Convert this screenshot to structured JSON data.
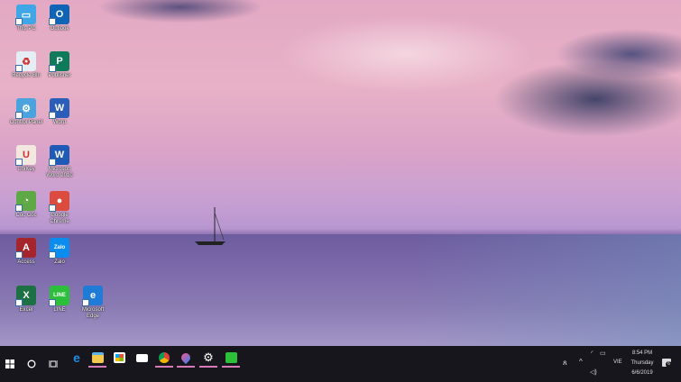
{
  "desktop_icons": [
    {
      "label": "This PC",
      "color": "#3fa7e6",
      "glyph": "▭"
    },
    {
      "label": "Outlook",
      "color": "#0f64b5",
      "glyph": "O"
    },
    {
      "label": "Recycle Bin",
      "color": "#e6eef5",
      "glyph": "♻"
    },
    {
      "label": "Publisher",
      "color": "#0e7a5a",
      "glyph": "P"
    },
    {
      "label": "Control Panel",
      "color": "#4aa3df",
      "glyph": "⚙"
    },
    {
      "label": "Word",
      "color": "#2b5eb8",
      "glyph": "W"
    },
    {
      "label": "UniKey",
      "color": "#f2e8e0",
      "glyph": "U"
    },
    {
      "label": "Microsoft Word 2010",
      "color": "#1f5bb5",
      "glyph": "W"
    },
    {
      "label": "Cốc Cốc",
      "color": "#5ea945",
      "glyph": "◔"
    },
    {
      "label": "Google Chrome",
      "color": "#dd4b3e",
      "glyph": "●"
    },
    {
      "label": "Access",
      "color": "#a4262c",
      "glyph": "A"
    },
    {
      "label": "Zalo",
      "color": "#0b8df0",
      "glyph": "Zalo"
    },
    {
      "label": "Excel",
      "color": "#1d7044",
      "glyph": "X"
    },
    {
      "label": "LINE",
      "color": "#2cbf3a",
      "glyph": "LINE"
    },
    {
      "label": "Microsoft Edge",
      "color": "#1f7bd6",
      "glyph": "e"
    }
  ],
  "taskbar": {
    "apps": [
      "edge",
      "file-explorer",
      "store",
      "mail",
      "chrome",
      "maps",
      "settings",
      "line"
    ],
    "language": "VIE",
    "time": "8:54 PM",
    "day": "Thursday",
    "date": "6/6/2019",
    "notification_count": "6"
  }
}
